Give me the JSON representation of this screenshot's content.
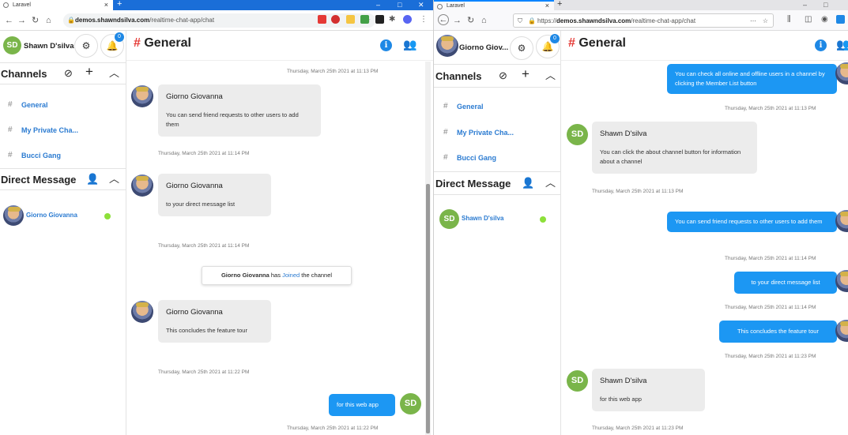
{
  "left": {
    "tab_title": "Laravel",
    "url_host": "demos.shawndsilva.com",
    "url_path": "/realtime-chat-app/chat",
    "user_initials": "SD",
    "user_name": "Shawn D'silva",
    "notif_count": "0",
    "channel_title": "General",
    "channels_heading": "Channels",
    "channels": [
      "General",
      "My Private Cha...",
      "Bucci Gang"
    ],
    "dm_heading": "Direct Message",
    "dm_user": "Giorno Giovanna",
    "ts_top": "Thursday, March 25th 2021 at 11:13 PM",
    "m1_name": "Giorno Giovanna",
    "m1_text": "You can send friend requests to other users to add them",
    "m1_ts": "Thursday, March 25th 2021 at 11:14 PM",
    "m2_name": "Giorno Giovanna",
    "m2_text": "to your direct message list",
    "m2_ts": "Thursday, March 25th 2021 at 11:14 PM",
    "sys_name": "Giorno Giovanna",
    "sys_has": "has",
    "sys_action": "Joined",
    "sys_rest": "the channel",
    "m3_name": "Giorno Giovanna",
    "m3_text": "This concludes the feature tour",
    "m3_ts": "Thursday, March 25th 2021 at 11:22 PM",
    "m4_text": "for this web app",
    "m4_initials": "SD",
    "m4_ts": "Thursday, March 25th 2021 at 11:22 PM"
  },
  "right": {
    "tab_title": "Laravel",
    "url_prefix": "https://",
    "url_host": "demos.shawndsilva.com",
    "url_path": "/realtime-chat-app/chat",
    "user_name": "Giorno Giov...",
    "notif_count": "0",
    "channel_title": "General",
    "channels_heading": "Channels",
    "channels": [
      "General",
      "My Private Cha...",
      "Bucci Gang"
    ],
    "dm_heading": "Direct Message",
    "dm_initials": "SD",
    "dm_user": "Shawn D'silva",
    "o1_text": "You can check all online and offline users in a channel by clicking the Member List button",
    "o1_ts": "Thursday, March 25th 2021 at 11:13 PM",
    "i1_initials": "SD",
    "i1_name": "Shawn D'silva",
    "i1_text": "You can click the about channel button for information about a channel",
    "i1_ts": "Thursday, March 25th 2021 at 11:13 PM",
    "o2_text": "You can send friend requests to other users to add them",
    "o2_ts": "Thursday, March 25th 2021 at 11:14 PM",
    "o3_text": "to your direct message list",
    "o3_ts": "Thursday, March 25th 2021 at 11:14 PM",
    "o4_text": "This concludes the feature tour",
    "o4_ts": "Thursday, March 25th 2021 at 11:23 PM",
    "i2_initials": "SD",
    "i2_name": "Shawn D'silva",
    "i2_text": "for this web app",
    "i2_ts": "Thursday, March 25th 2021 at 11:23 PM"
  },
  "icons": {
    "settings": "gear-icon",
    "notifications": "bell-icon",
    "explore": "compass-icon",
    "add": "plus-icon",
    "collapse": "chevron-up-icon",
    "add_user": "user-plus-icon",
    "info": "info-icon",
    "members": "users-icon"
  },
  "colors": {
    "accent": "#1e88e5",
    "hash": "#e53935",
    "online": "#8de03a",
    "avatar_sd": "#7ab54a",
    "outgoing_bubble": "#1c97f3",
    "incoming_bubble": "#ececec"
  }
}
